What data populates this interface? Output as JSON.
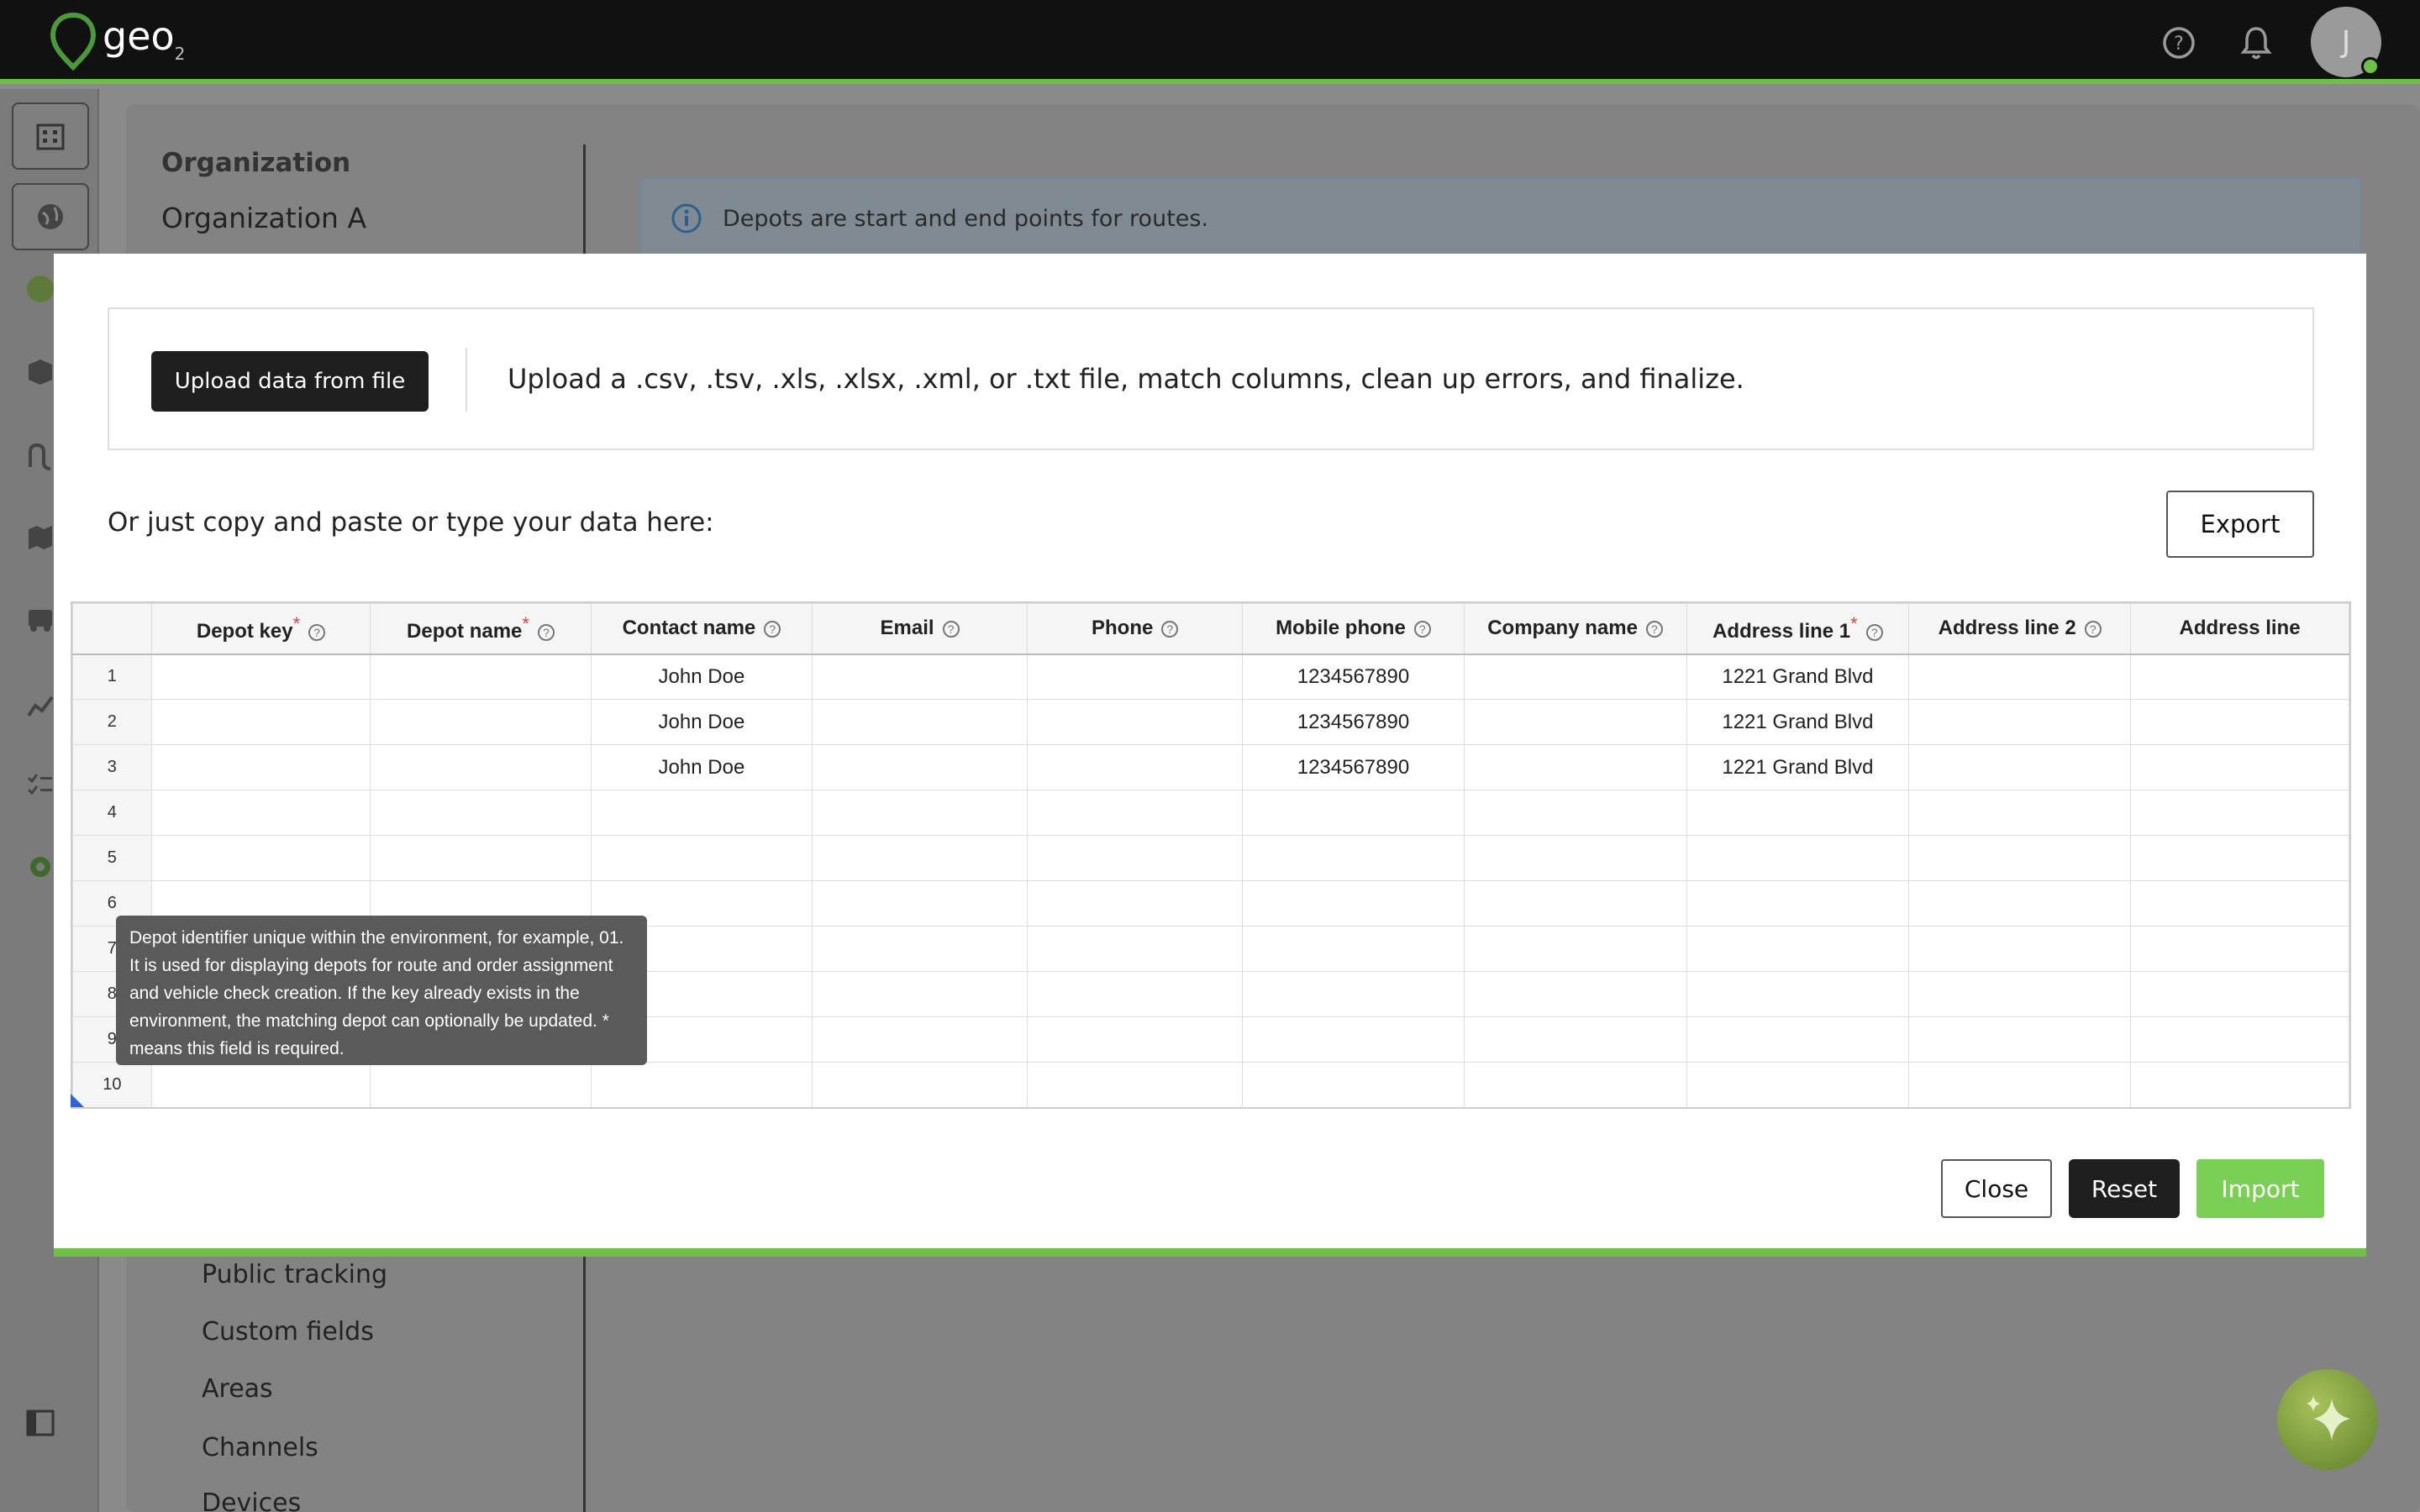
{
  "app": {
    "logo_text": "geo",
    "logo_sub": "2",
    "avatar_initial": "J",
    "accent": "#6ec046"
  },
  "topbar": {
    "icons": [
      "help-icon",
      "bell-icon"
    ]
  },
  "rail": {
    "icons": [
      "building-icon",
      "globe-icon",
      "box-icon",
      "route-icon",
      "map-icon",
      "truck-icon",
      "chart-icon",
      "checklist-icon",
      "gear-icon",
      "sidebar-toggle-icon"
    ]
  },
  "org": {
    "label": "Organization",
    "name": "Organization A"
  },
  "info_banner": {
    "text": "Depots are start and end points for routes."
  },
  "bg_nav": {
    "items": [
      "Public tracking",
      "Custom fields",
      "Areas",
      "Channels",
      "Devices"
    ]
  },
  "modal": {
    "upload_button": "Upload data from file",
    "upload_text": "Upload a .csv, .tsv, .xls, .xlsx, .xml, or .txt file, match columns, clean up errors, and finalize.",
    "paste_text": "Or just copy and paste or type your data here:",
    "export_button": "Export",
    "close_button": "Close",
    "reset_button": "Reset",
    "import_button": "Import"
  },
  "grid": {
    "columns": [
      {
        "label": "Depot key",
        "required": true
      },
      {
        "label": "Depot name",
        "required": true
      },
      {
        "label": "Contact name",
        "required": false
      },
      {
        "label": "Email",
        "required": false
      },
      {
        "label": "Phone",
        "required": false
      },
      {
        "label": "Mobile phone",
        "required": false
      },
      {
        "label": "Company name",
        "required": false
      },
      {
        "label": "Address line 1",
        "required": true
      },
      {
        "label": "Address line 2",
        "required": false
      },
      {
        "label": "Address line",
        "required": false
      }
    ],
    "rows": [
      {
        "num": "1",
        "cells": [
          "",
          "",
          "John Doe",
          "",
          "",
          "1234567890",
          "",
          "1221 Grand Blvd",
          "",
          ""
        ]
      },
      {
        "num": "2",
        "cells": [
          "",
          "",
          "John Doe",
          "",
          "",
          "1234567890",
          "",
          "1221 Grand Blvd",
          "",
          ""
        ]
      },
      {
        "num": "3",
        "cells": [
          "",
          "",
          "John Doe",
          "",
          "",
          "1234567890",
          "",
          "1221 Grand Blvd",
          "",
          ""
        ]
      },
      {
        "num": "4",
        "cells": [
          "",
          "",
          "",
          "",
          "",
          "",
          "",
          "",
          "",
          ""
        ]
      },
      {
        "num": "5",
        "cells": [
          "",
          "",
          "",
          "",
          "",
          "",
          "",
          "",
          "",
          ""
        ]
      },
      {
        "num": "6",
        "cells": [
          "",
          "",
          "",
          "",
          "",
          "",
          "",
          "",
          "",
          ""
        ]
      },
      {
        "num": "7",
        "cells": [
          "",
          "",
          "",
          "",
          "",
          "",
          "",
          "",
          "",
          ""
        ]
      },
      {
        "num": "8",
        "cells": [
          "",
          "",
          "",
          "",
          "",
          "",
          "",
          "",
          "",
          ""
        ]
      },
      {
        "num": "9",
        "cells": [
          "",
          "",
          "",
          "",
          "",
          "",
          "",
          "",
          "",
          ""
        ]
      },
      {
        "num": "10",
        "cells": [
          "",
          "",
          "",
          "",
          "",
          "",
          "",
          "",
          "",
          ""
        ]
      }
    ],
    "required_mark": "*",
    "help_glyph": "?"
  },
  "tooltip": {
    "text": "Depot identifier unique within the environment, for example, 01. It is used for displaying depots for route and order assignment and vehicle check creation. If the key already exists in the environment, the matching depot can optionally be updated. * means this field is required."
  }
}
